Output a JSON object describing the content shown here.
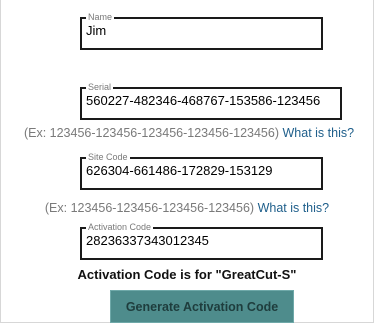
{
  "fields": {
    "name": {
      "label": "Name",
      "value": "Jim"
    },
    "serial": {
      "label": "Serial",
      "value": "560227-482346-468767-153586-123456"
    },
    "site_code": {
      "label": "Site Code",
      "value": "626304-661486-172829-153129"
    },
    "activation_code": {
      "label": "Activation Code",
      "value": "28236337343012345"
    }
  },
  "serial_hint": {
    "example": "(Ex: 123456-123456-123456-123456-123456)",
    "link": "What is this?"
  },
  "site_code_hint": {
    "example": "(Ex: 123456-123456-123456-123456)",
    "link": "What is this?"
  },
  "product_message": "Activation Code is for \"GreatCut-S\"",
  "generate_button_label": "Generate Activation Code",
  "colors": {
    "button_bg": "#4e8c8c",
    "link": "#1f5f8b",
    "hint_text": "#7a7a7a"
  }
}
